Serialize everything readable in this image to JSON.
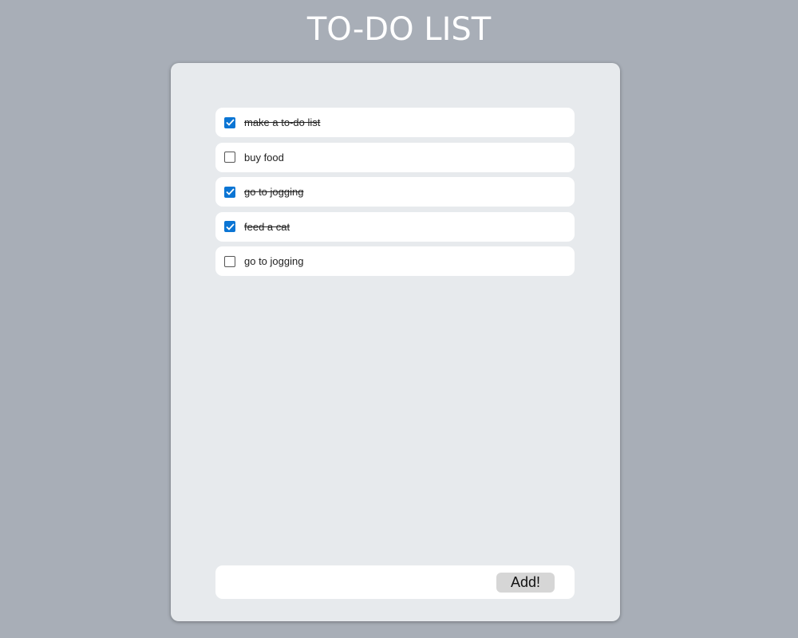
{
  "header": {
    "title": "TO-DO LIST"
  },
  "todos": [
    {
      "text": "make a to-do list",
      "done": true
    },
    {
      "text": "buy food",
      "done": false
    },
    {
      "text": "go to jogging",
      "done": true
    },
    {
      "text": "feed a cat",
      "done": true
    },
    {
      "text": "go to jogging",
      "done": false
    }
  ],
  "add_form": {
    "input_value": "",
    "button_label": "Add!"
  },
  "colors": {
    "background": "#a8aeb7",
    "card": "#e7eaed",
    "checkbox_checked": "#0b75d4",
    "button": "#d6d6d6"
  }
}
